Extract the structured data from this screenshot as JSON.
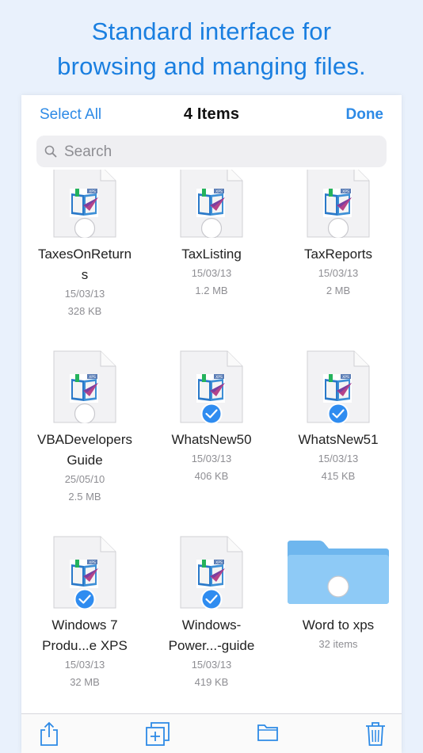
{
  "headline": {
    "line1": "Standard interface for",
    "line2": "browsing and manging files."
  },
  "navbar": {
    "select_all": "Select All",
    "title": "4 Items",
    "done": "Done"
  },
  "search": {
    "placeholder": "Search",
    "icon": "search-icon"
  },
  "files": [
    {
      "name_lines": [
        "TaxesOnReturn",
        "s"
      ],
      "date": "15/03/13",
      "size": "328 KB",
      "kind": "xps",
      "selected": false
    },
    {
      "name_lines": [
        "TaxListing"
      ],
      "date": "15/03/13",
      "size": "1.2 MB",
      "kind": "xps",
      "selected": false
    },
    {
      "name_lines": [
        "TaxReports"
      ],
      "date": "15/03/13",
      "size": "2 MB",
      "kind": "xps",
      "selected": false
    },
    {
      "name_lines": [
        "VBADevelopers",
        "Guide"
      ],
      "date": "25/05/10",
      "size": "2.5 MB",
      "kind": "xps",
      "selected": false
    },
    {
      "name_lines": [
        "WhatsNew50"
      ],
      "date": "15/03/13",
      "size": "406 KB",
      "kind": "xps",
      "selected": true
    },
    {
      "name_lines": [
        "WhatsNew51"
      ],
      "date": "15/03/13",
      "size": "415 KB",
      "kind": "xps",
      "selected": true
    },
    {
      "name_lines": [
        "Windows 7",
        "Produ...e XPS"
      ],
      "date": "15/03/13",
      "size": "32 MB",
      "kind": "xps",
      "selected": true
    },
    {
      "name_lines": [
        "Windows-",
        "Power...-guide"
      ],
      "date": "15/03/13",
      "size": "419 KB",
      "kind": "xps",
      "selected": true
    },
    {
      "name_lines": [
        "Word to xps"
      ],
      "count": "32 items",
      "kind": "folder",
      "selected": false
    }
  ],
  "file_badge_text": "XPS",
  "toolbar": {
    "icons": [
      "share-icon",
      "duplicate-icon",
      "folder-icon",
      "trash-icon"
    ]
  },
  "colors": {
    "accent": "#2d8ae6",
    "headline": "#1a7fe0",
    "background": "#e9f1fc",
    "check": "#2f8cf0",
    "folder": "#78bff3"
  }
}
